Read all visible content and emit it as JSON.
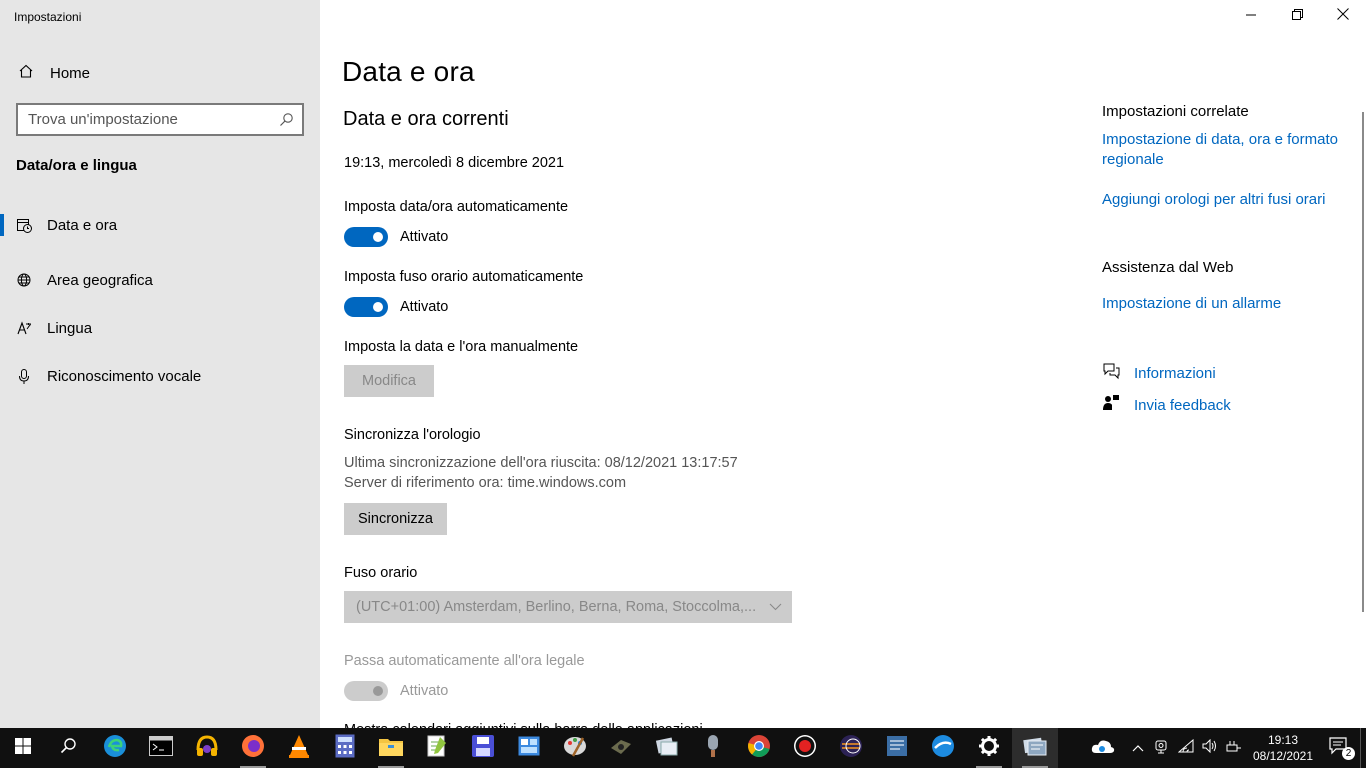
{
  "window": {
    "title": "Impostazioni",
    "controls": [
      "minimize",
      "restore",
      "close"
    ]
  },
  "sidebar": {
    "home_label": "Home",
    "search_placeholder": "Trova un'impostazione",
    "section_title": "Data/ora e lingua",
    "items": [
      {
        "label": "Data e ora",
        "icon": "calendar-clock-icon",
        "active": true
      },
      {
        "label": "Area geografica",
        "icon": "globe-icon",
        "active": false
      },
      {
        "label": "Lingua",
        "icon": "language-icon",
        "active": false
      },
      {
        "label": "Riconoscimento vocale",
        "icon": "microphone-icon",
        "active": false
      }
    ]
  },
  "main": {
    "title": "Data e ora",
    "subtitle": "Data e ora correnti",
    "current_datetime": "19:13, mercoledì 8 dicembre 2021",
    "auto_time": {
      "label": "Imposta data/ora automaticamente",
      "state": "Attivato",
      "on": true
    },
    "auto_timezone": {
      "label": "Imposta fuso orario automaticamente",
      "state": "Attivato",
      "on": true
    },
    "manual": {
      "label": "Imposta la data e l'ora manualmente",
      "button": "Modifica"
    },
    "sync": {
      "label": "Sincronizza l'orologio",
      "last_sync": "Ultima sincronizzazione dell'ora riuscita: 08/12/2021 13:17:57",
      "server": "Server di riferimento ora: time.windows.com",
      "button": "Sincronizza"
    },
    "timezone": {
      "label": "Fuso orario",
      "selected": "(UTC+01:00) Amsterdam, Berlino, Berna, Roma, Stoccolma,..."
    },
    "dst": {
      "label": "Passa automaticamente all'ora legale",
      "state": "Attivato",
      "on": true,
      "disabled": true
    },
    "cut_off_text": "Mostra calendari aggiuntivi sulla barra delle applicazioni"
  },
  "related": {
    "heading": "Impostazioni correlate",
    "links": [
      "Impostazione di data, ora e formato regionale",
      "Aggiungi orologi per altri fusi orari"
    ],
    "web_heading": "Assistenza dal Web",
    "web_link": "Impostazione di un allarme",
    "info_link": "Informazioni",
    "feedback_link": "Invia feedback"
  },
  "taskbar": {
    "time": "19:13",
    "date": "08/12/2021",
    "notification_count": "2",
    "apps": [
      "start-icon",
      "search-icon",
      "edge-icon",
      "terminal-icon",
      "audio-app-icon",
      "firefox-icon",
      "vlc-icon",
      "calculator-icon",
      "file-explorer-icon",
      "notepad-plus-icon",
      "save-icon",
      "control-panel-icon",
      "paint-icon",
      "camera-icon",
      "scanner-icon",
      "microphone-icon",
      "chrome-icon",
      "recorder-icon",
      "eclipse-icon",
      "sticky-notes-icon",
      "paint-brush-icon",
      "settings-icon",
      "network-settings-icon"
    ]
  },
  "colors": {
    "accent": "#0067c0",
    "sidebar_bg": "#e6e6e6",
    "taskbar_bg": "#101010"
  }
}
